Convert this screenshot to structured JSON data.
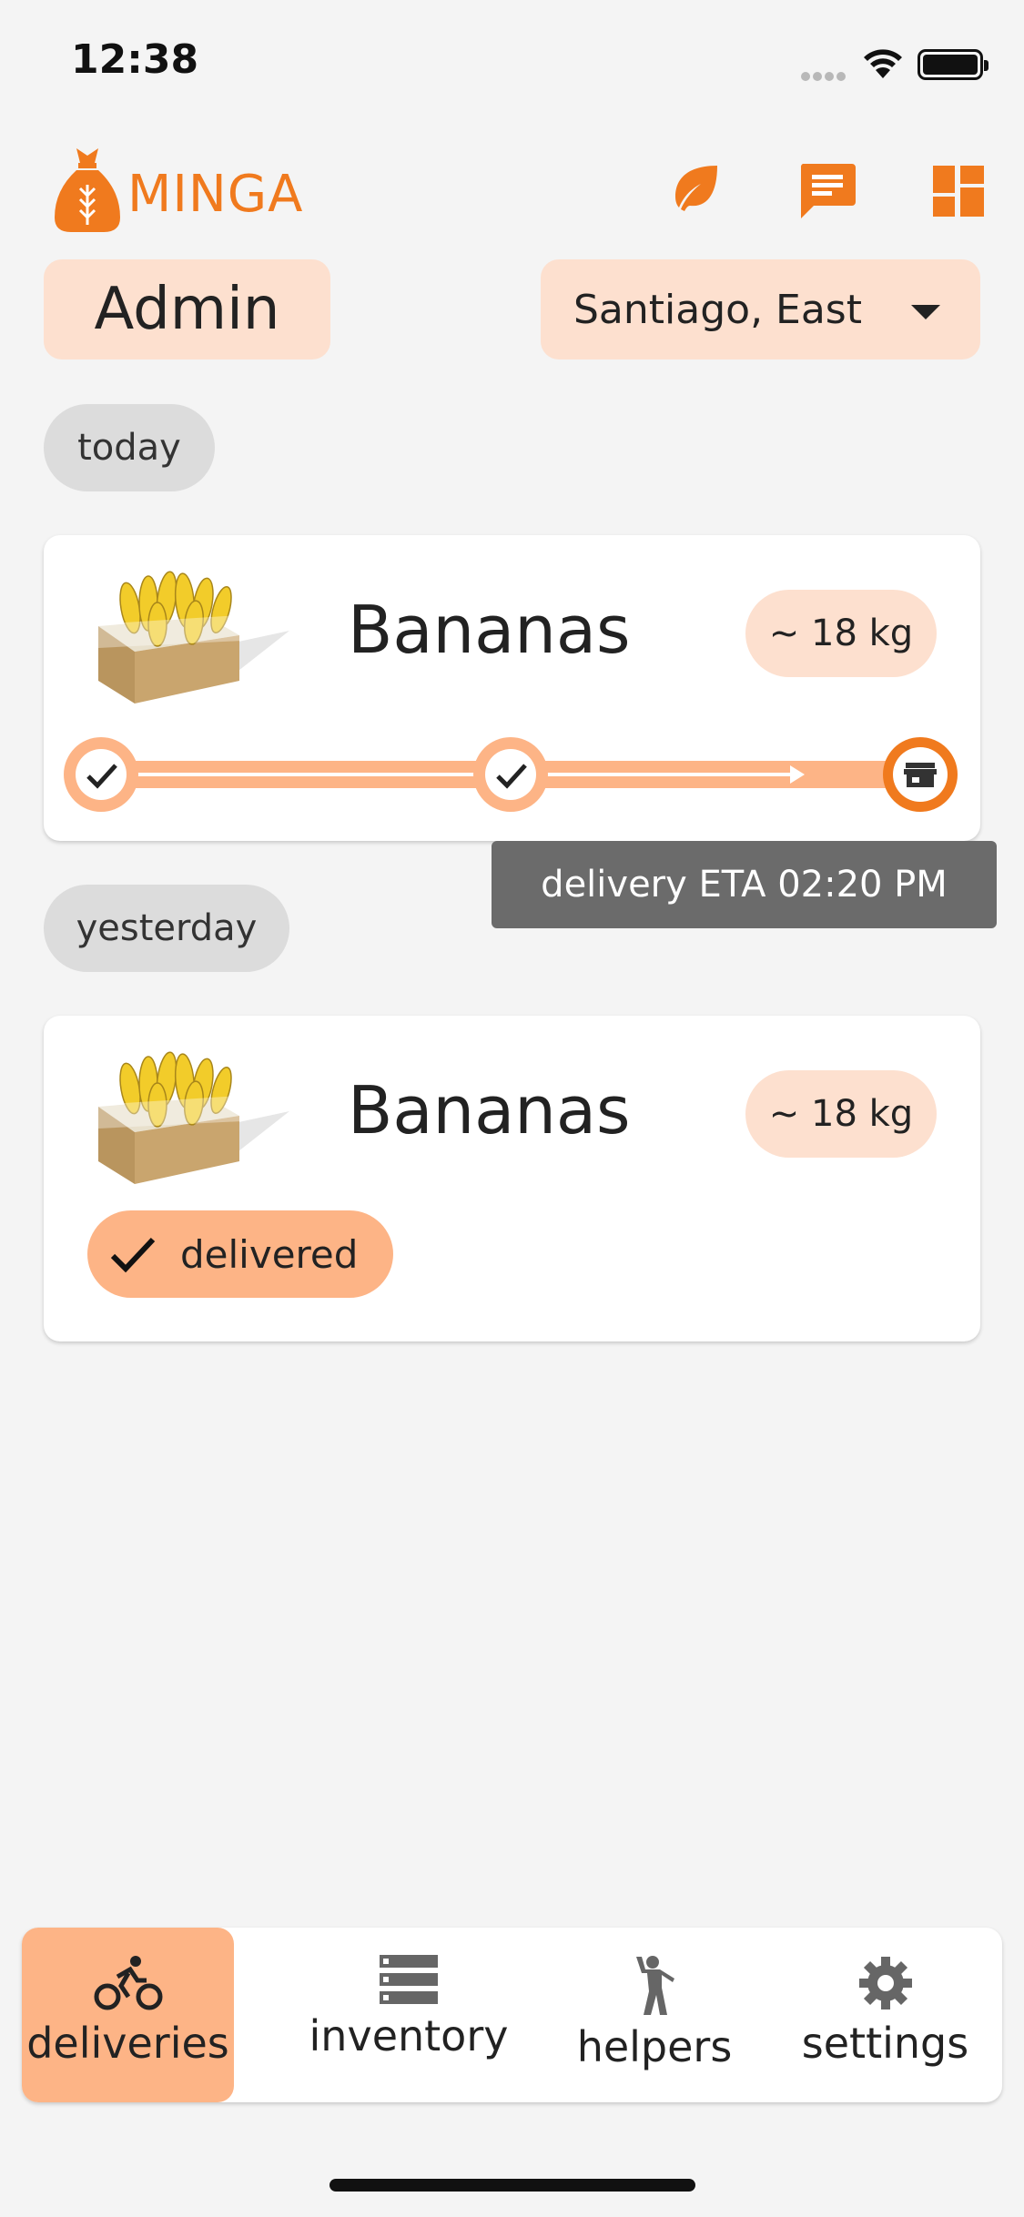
{
  "status_bar": {
    "time": "12:38"
  },
  "header": {
    "app_name": "MINGA",
    "icons": [
      "leaf-icon",
      "message-icon",
      "dashboard-icon"
    ]
  },
  "role": "Admin",
  "location": {
    "selected": "Santiago, East"
  },
  "colors": {
    "brand": "#f07a1e",
    "chip_light": "#fde0cf",
    "chip_strong": "#fdb486",
    "tooltip": "#6b6b6b"
  },
  "sections": [
    {
      "label": "today",
      "card": {
        "product": "Bananas",
        "weight": "~ 18 kg",
        "progress_steps": [
          "done",
          "done",
          "current"
        ],
        "tooltip": "delivery ETA 02:20 PM"
      }
    },
    {
      "label": "yesterday",
      "card": {
        "product": "Bananas",
        "weight": "~ 18 kg",
        "status": "delivered"
      }
    }
  ],
  "bottom_nav": [
    {
      "label": "deliveries",
      "icon": "bike-icon",
      "active": true
    },
    {
      "label": "inventory",
      "icon": "list-icon",
      "active": false
    },
    {
      "label": "helpers",
      "icon": "person-waving-icon",
      "active": false
    },
    {
      "label": "settings",
      "icon": "gear-icon",
      "active": false
    }
  ]
}
